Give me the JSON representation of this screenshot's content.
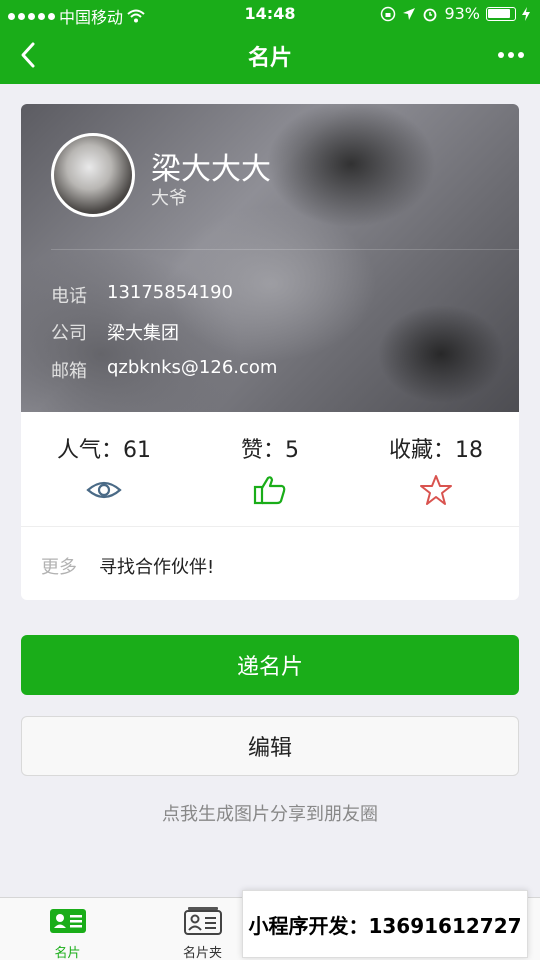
{
  "status": {
    "carrier": "中国移动",
    "time": "14:48",
    "battery": "93%"
  },
  "nav": {
    "title": "名片",
    "back_icon": "chevron-left-icon",
    "more_icon": "more-dots-icon"
  },
  "card": {
    "name": "梁大大大",
    "subtitle": "大爷",
    "info": [
      {
        "label": "电话",
        "value": "13175854190"
      },
      {
        "label": "公司",
        "value": "梁大集团"
      },
      {
        "label": "邮箱",
        "value": "qzbknks@126.com"
      }
    ],
    "stats": [
      {
        "label": "人气：61",
        "icon": "eye-icon",
        "color": "#4a6a86"
      },
      {
        "label": "赞：5",
        "icon": "thumbs-up-icon",
        "color": "#1aad19"
      },
      {
        "label": "收藏：18",
        "icon": "star-icon",
        "color": "#d9534f"
      }
    ],
    "more_label": "更多",
    "more_value": "寻找合作伙伴!"
  },
  "actions": {
    "primary_label": "递名片",
    "secondary_label": "编辑",
    "share_text": "点我生成图片分享到朋友圈"
  },
  "tabbar": {
    "items": [
      {
        "label": "名片",
        "icon": "card-icon",
        "active": true
      },
      {
        "label": "名片夹",
        "icon": "card-holder-icon",
        "active": false
      },
      {
        "label": "",
        "icon": "",
        "active": false
      },
      {
        "label": "",
        "icon": "",
        "active": false
      }
    ]
  },
  "overlay": {
    "text": "小程序开发：13691612727"
  },
  "colors": {
    "brand_green": "#1aad19",
    "page_bg": "#efeff4"
  }
}
